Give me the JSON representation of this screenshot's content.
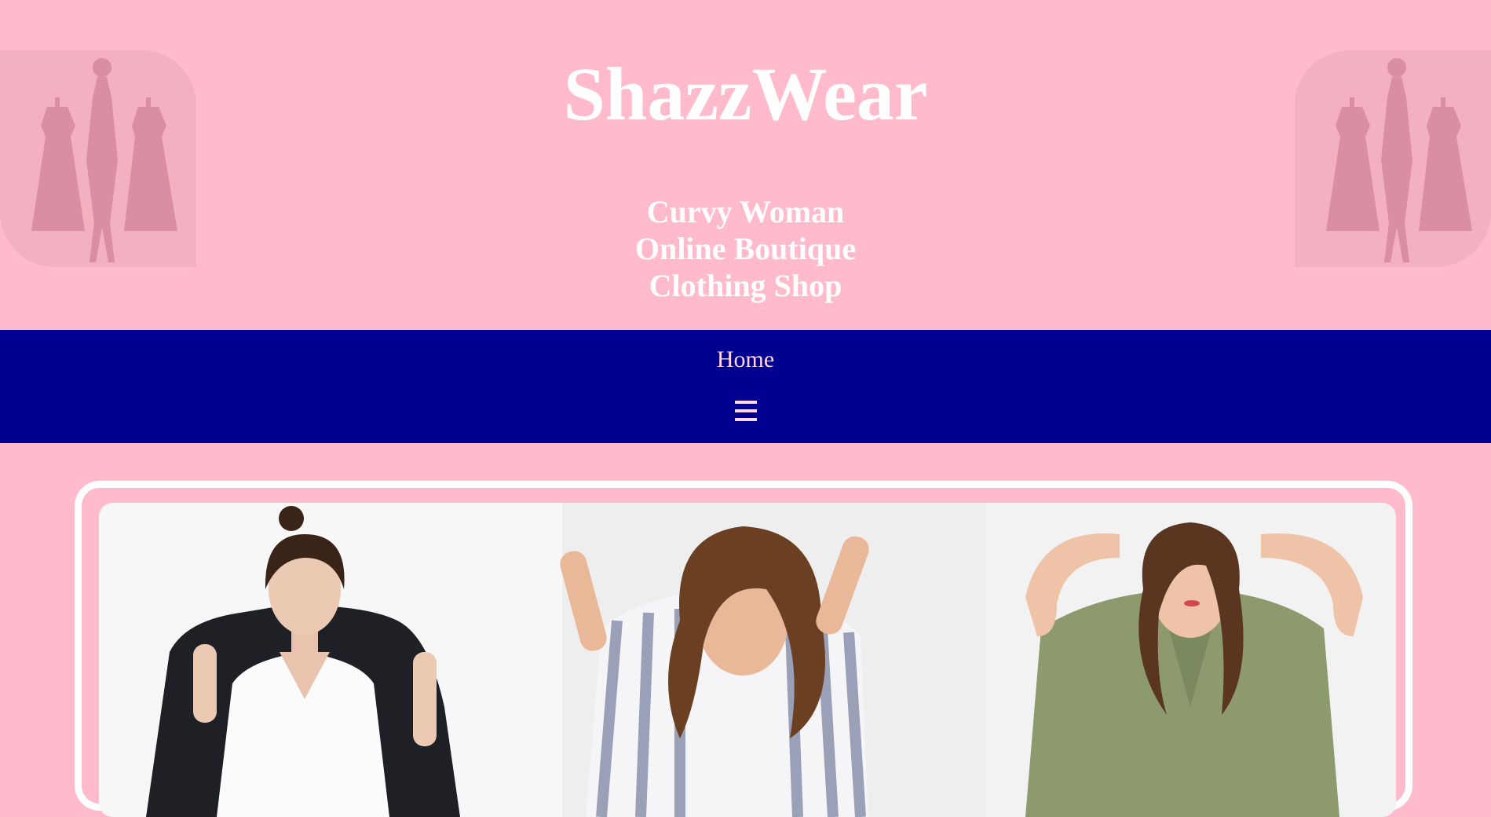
{
  "header": {
    "title": "ShazzWear",
    "tagline_lines": [
      "Curvy Woman",
      "Online Boutique",
      "Clothing Shop"
    ]
  },
  "nav": {
    "home_label": "Home",
    "menu_icon": "hamburger-menu-icon"
  },
  "colors": {
    "page_background": "#ffbacb",
    "nav_background": "#000090",
    "nav_text": "#ffd6e3",
    "title_text": "#ffffff"
  },
  "banner": {
    "icon": "fashion-models-photo"
  }
}
